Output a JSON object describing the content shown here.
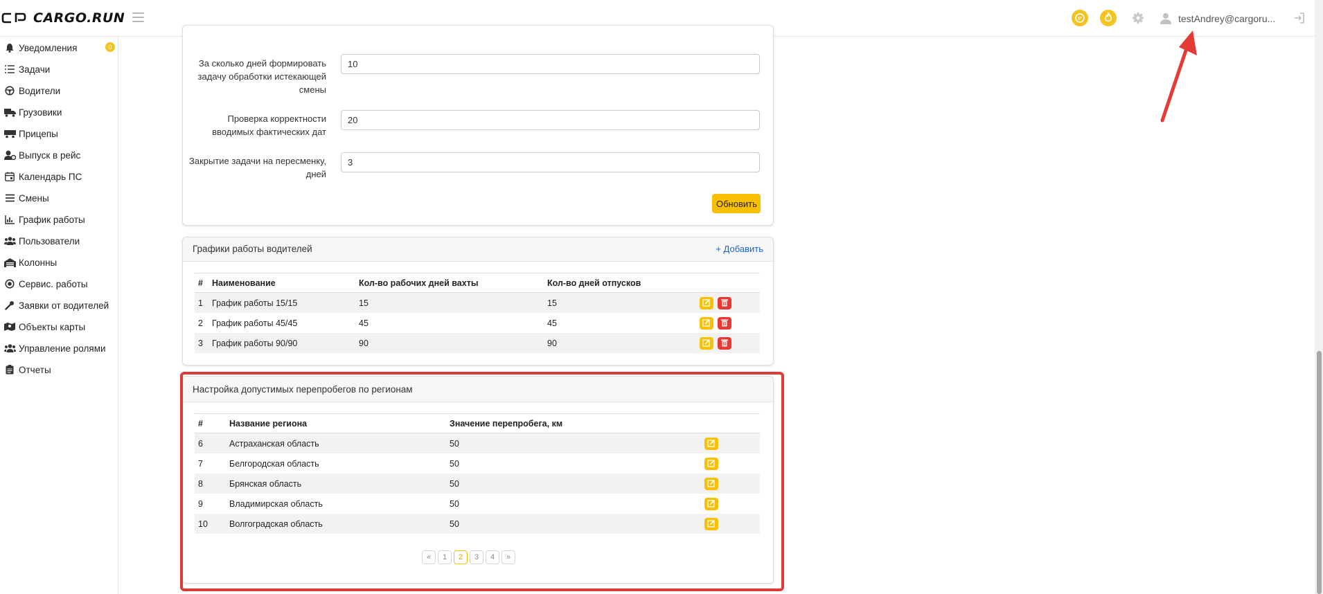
{
  "header": {
    "logo_text": "CARGO.RUN",
    "user_name": "testAndrey@cargoru...",
    "icons": [
      "chat-icon",
      "fire-icon",
      "gear-icon",
      "user-icon",
      "logout-icon"
    ]
  },
  "sidebar": {
    "items": [
      {
        "label": "Уведомления",
        "icon": "bell-icon",
        "badge": "0"
      },
      {
        "label": "Задачи",
        "icon": "task-list-icon"
      },
      {
        "label": "Водители",
        "icon": "steering-wheel-icon"
      },
      {
        "label": "Грузовики",
        "icon": "truck-icon"
      },
      {
        "label": "Прицепы",
        "icon": "trailer-icon"
      },
      {
        "label": "Выпуск в рейс",
        "icon": "user-dispatch-icon"
      },
      {
        "label": "Календарь ПС",
        "icon": "calendar-icon"
      },
      {
        "label": "Смены",
        "icon": "list-icon"
      },
      {
        "label": "График работы",
        "icon": "chart-icon"
      },
      {
        "label": "Пользователи",
        "icon": "users-icon"
      },
      {
        "label": "Колонны",
        "icon": "garage-icon"
      },
      {
        "label": "Сервис. работы",
        "icon": "service-icon"
      },
      {
        "label": "Заявки от водителей",
        "icon": "wrench-icon"
      },
      {
        "label": "Объекты карты",
        "icon": "map-icon"
      },
      {
        "label": "Управление ролями",
        "icon": "roles-icon"
      },
      {
        "label": "Отчеты",
        "icon": "clipboard-icon"
      }
    ]
  },
  "settings_form": {
    "fields": [
      {
        "label": "За сколько дней формировать задачу обработки истекающей смены",
        "value": "10"
      },
      {
        "label": "Проверка корректности вводимых фактических дат",
        "value": "20"
      },
      {
        "label": "Закрытие задачи на пересменку, дней",
        "value": "3"
      }
    ],
    "update_button": "Обновить"
  },
  "schedules": {
    "title": "Графики работы водителей",
    "add_label": "+ Добавить",
    "columns": [
      "#",
      "Наименование",
      "Кол-во рабочих дней вахты",
      "Кол-во дней отпусков"
    ],
    "rows": [
      {
        "id": "1",
        "name": "График работы 15/15",
        "work_days": "15",
        "vacation_days": "15"
      },
      {
        "id": "2",
        "name": "График работы 45/45",
        "work_days": "45",
        "vacation_days": "45"
      },
      {
        "id": "3",
        "name": "График работы 90/90",
        "work_days": "90",
        "vacation_days": "90"
      }
    ]
  },
  "regions": {
    "title": "Настройка допустимых перепробегов по регионам",
    "columns": [
      "#",
      "Название региона",
      "Значение перепробега, км"
    ],
    "rows": [
      {
        "id": "6",
        "name": "Астраханская область",
        "value": "50"
      },
      {
        "id": "7",
        "name": "Белгородская область",
        "value": "50"
      },
      {
        "id": "8",
        "name": "Брянская область",
        "value": "50"
      },
      {
        "id": "9",
        "name": "Владимирская область",
        "value": "50"
      },
      {
        "id": "10",
        "name": "Волгоградская область",
        "value": "50"
      }
    ],
    "pagination": {
      "prev": "«",
      "pages": [
        "1",
        "2",
        "3",
        "4"
      ],
      "current": "2",
      "next": "»"
    }
  },
  "colors": {
    "accent": "#f8c000",
    "danger": "#e53935",
    "link": "#1a61d4",
    "highlight": "#dd3b39"
  }
}
